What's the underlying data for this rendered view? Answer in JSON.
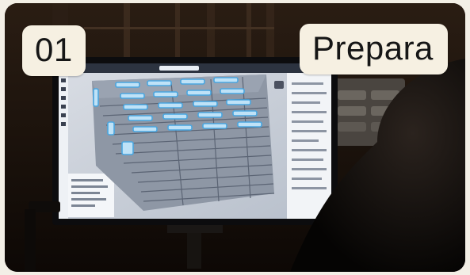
{
  "step_number": "01",
  "step_title": "Prepara",
  "colors": {
    "badge_bg": "#f6f0e2",
    "badge_text": "#161616",
    "scene_dark": "#1a110a",
    "model_blue": "#4aa6e0",
    "model_gray": "#7b8696"
  },
  "scene": {
    "description_icon": "monitor-with-3d-model-icon"
  }
}
